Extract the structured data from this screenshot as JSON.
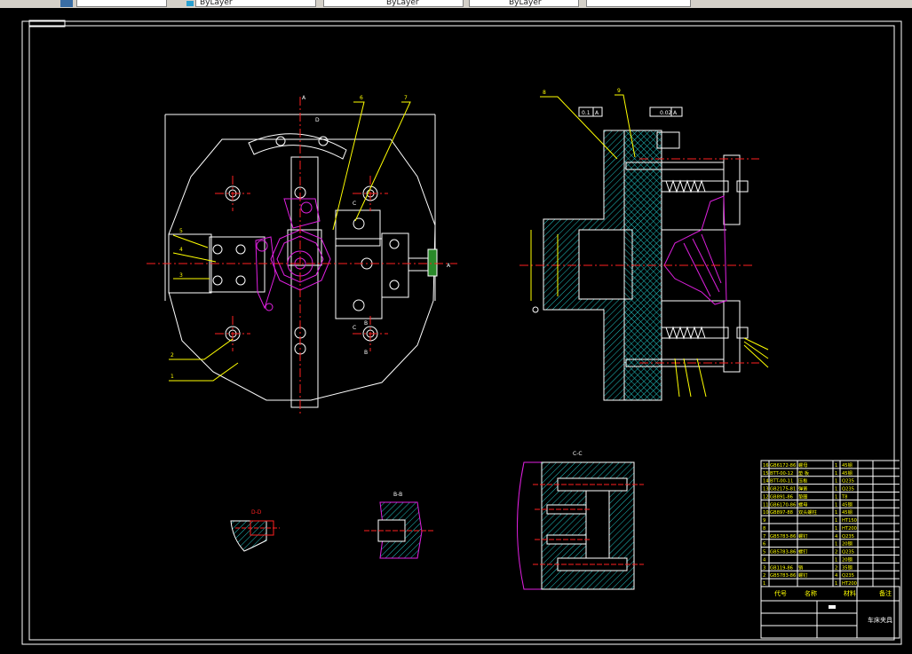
{
  "toolbar": {
    "layer_selector_value": "",
    "color_selector_value": "ByLayer",
    "linetype_selector_value": "ByLayer",
    "lineweight_selector_value": "ByLayer",
    "plotstyle_selector_value": ""
  },
  "drawing": {
    "view_labels": {
      "section_a": "A",
      "section_b": "B",
      "section_c": "C",
      "section_d": "D",
      "view_cc": "C-C",
      "view_bb": "B-B",
      "view_dd": "D-D"
    },
    "part_callouts": [
      "1",
      "2",
      "3",
      "4",
      "5",
      "6",
      "7",
      "8",
      "9"
    ],
    "tolerance_frames": [
      "0.1",
      "A",
      "0.02",
      "A"
    ],
    "title_block": {
      "drawing_name": "车床夹具",
      "header_code": "代号",
      "header_name": "名称",
      "header_material": "材料",
      "header_remark": "备注"
    },
    "bom_rows": [
      {
        "no": "16",
        "code": "GB6172-86",
        "name": "螺母",
        "qty": "1",
        "mat": "45钢"
      },
      {
        "no": "15",
        "code": "BTT-00-12",
        "name": "垫 板",
        "qty": "1",
        "mat": "45钢"
      },
      {
        "no": "14",
        "code": "BTT-00-11",
        "name": "压板",
        "qty": "1",
        "mat": "Q235"
      },
      {
        "no": "13",
        "code": "GB2175-81",
        "name": "弹簧",
        "qty": "1",
        "mat": "Q235"
      },
      {
        "no": "12",
        "code": "GB891-86",
        "name": "垫圈",
        "qty": "1",
        "mat": "T8"
      },
      {
        "no": "11",
        "code": "GB6170-86",
        "name": "螺母",
        "qty": "1",
        "mat": "45钢"
      },
      {
        "no": "10",
        "code": "GB897-88",
        "name": "双头螺柱",
        "qty": "1",
        "mat": "45钢"
      },
      {
        "no": "9",
        "code": "",
        "name": "",
        "qty": "1",
        "mat": "HT150"
      },
      {
        "no": "8",
        "code": "",
        "name": "",
        "qty": "1",
        "mat": "HT200"
      },
      {
        "no": "7",
        "code": "GB5783-86",
        "name": "螺钉",
        "qty": "4",
        "mat": "Q235"
      },
      {
        "no": "6",
        "code": "",
        "name": "",
        "qty": "1",
        "mat": "20钢"
      },
      {
        "no": "5",
        "code": "GB5783-86",
        "name": "螺钉",
        "qty": "2",
        "mat": "Q235"
      },
      {
        "no": "4",
        "code": "",
        "name": "",
        "qty": "1",
        "mat": "20钢"
      },
      {
        "no": "3",
        "code": "GB119-86",
        "name": "销",
        "qty": "2",
        "mat": "35钢"
      },
      {
        "no": "2",
        "code": "GB5783-86",
        "name": "螺钉",
        "qty": "4",
        "mat": "Q235"
      },
      {
        "no": "1",
        "code": "",
        "name": "",
        "qty": "1",
        "mat": "HT200"
      }
    ]
  },
  "colors": {
    "background": "#000000",
    "outline": "#ffffff",
    "center_line": "#ff2020",
    "hatch": "#20c0c0",
    "leader": "#ffff00",
    "workpiece": "#e020e0",
    "title_text": "#ffff00"
  }
}
